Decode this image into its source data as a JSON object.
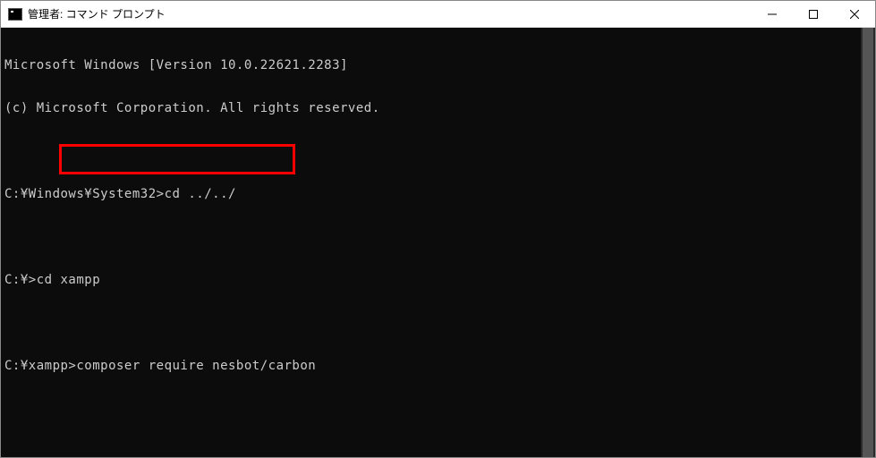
{
  "window": {
    "title": "管理者: コマンド プロンプト"
  },
  "terminal": {
    "line1": "Microsoft Windows [Version 10.0.22621.2283]",
    "line2": "(c) Microsoft Corporation. All rights reserved.",
    "line3": "C:¥Windows¥System32>cd ../../",
    "line4": "C:¥>cd xampp",
    "line5_prompt": "C:¥xampp>",
    "line5_command": "composer require nesbot/carbon"
  },
  "highlight": {
    "target": "composer require nesbot/carbon",
    "color": "#ff0000"
  }
}
